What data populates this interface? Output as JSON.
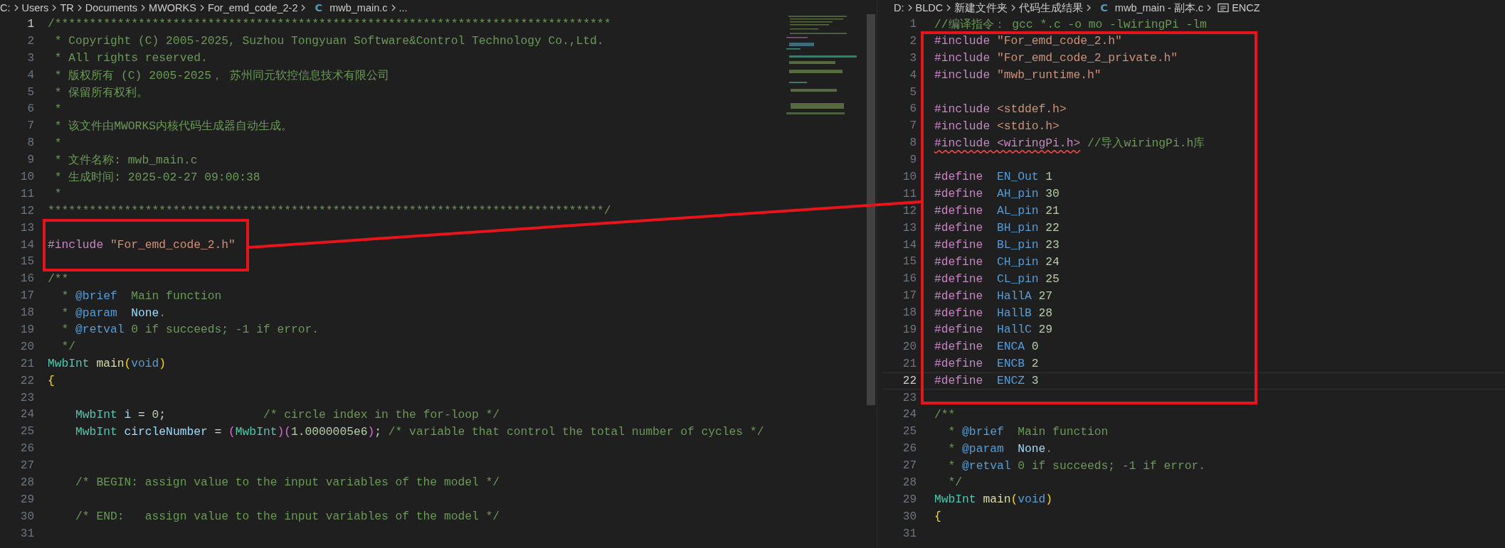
{
  "panes": [
    {
      "breadcrumb": [
        {
          "kind": "segment",
          "label": "C:"
        },
        {
          "kind": "segment",
          "label": "Users"
        },
        {
          "kind": "segment",
          "label": "TR"
        },
        {
          "kind": "segment",
          "label": "Documents"
        },
        {
          "kind": "segment",
          "label": "MWORKS"
        },
        {
          "kind": "segment",
          "label": "For_emd_code_2-2"
        },
        {
          "kind": "file",
          "icon": "C",
          "label": "mwb_main.c"
        },
        {
          "kind": "segment",
          "label": "..."
        }
      ],
      "lines": [
        {
          "number": "1",
          "active": true,
          "tokens": [
            {
              "kind": "c",
              "text": "/********************************************************************************"
            }
          ]
        },
        {
          "number": "2",
          "active": false,
          "tokens": [
            {
              "kind": "c",
              "text": " * Copyright (C) 2005-2025, Suzhou Tongyuan Software&Control Technology Co.,Ltd."
            }
          ]
        },
        {
          "number": "3",
          "active": false,
          "tokens": [
            {
              "kind": "c",
              "text": " * All rights reserved."
            }
          ]
        },
        {
          "number": "4",
          "active": false,
          "tokens": [
            {
              "kind": "c",
              "text": " * 版权所有 (C) 2005-2025， 苏州同元软控信息技术有限公司"
            }
          ]
        },
        {
          "number": "5",
          "active": false,
          "tokens": [
            {
              "kind": "c",
              "text": " * 保留所有权利。"
            }
          ]
        },
        {
          "number": "6",
          "active": false,
          "tokens": [
            {
              "kind": "c",
              "text": " *"
            }
          ]
        },
        {
          "number": "7",
          "active": false,
          "tokens": [
            {
              "kind": "c",
              "text": " * 该文件由MWORKS内核代码生成器自动生成。"
            }
          ]
        },
        {
          "number": "8",
          "active": false,
          "tokens": [
            {
              "kind": "c",
              "text": " *"
            }
          ]
        },
        {
          "number": "9",
          "active": false,
          "tokens": [
            {
              "kind": "c",
              "text": " * 文件名称: mwb_main.c"
            }
          ]
        },
        {
          "number": "10",
          "active": false,
          "tokens": [
            {
              "kind": "c",
              "text": " * 生成时间: 2025-02-27 09:00:38"
            }
          ]
        },
        {
          "number": "11",
          "active": false,
          "tokens": [
            {
              "kind": "c",
              "text": " *"
            }
          ]
        },
        {
          "number": "12",
          "active": false,
          "tokens": [
            {
              "kind": "c",
              "text": "********************************************************************************/"
            }
          ]
        },
        {
          "number": "13",
          "active": false
        },
        {
          "number": "14",
          "active": false,
          "tokens": [
            {
              "kind": "pp",
              "text": "#include"
            },
            {
              "kind": "s",
              "text": " \"For_emd_code_2.h\""
            }
          ]
        },
        {
          "number": "15",
          "active": false
        },
        {
          "number": "16",
          "active": false,
          "tokens": [
            {
              "kind": "c",
              "text": "/**"
            }
          ]
        },
        {
          "number": "17",
          "active": false,
          "tokens": [
            {
              "kind": "c",
              "text": "  * "
            },
            {
              "kind": "tag",
              "text": "@brief"
            },
            {
              "kind": "c",
              "text": "  Main function"
            }
          ]
        },
        {
          "number": "18",
          "active": false,
          "tokens": [
            {
              "kind": "c",
              "text": "  * "
            },
            {
              "kind": "tag",
              "text": "@param"
            },
            {
              "kind": "v",
              "text": "  None"
            },
            {
              "kind": "c",
              "text": "."
            }
          ]
        },
        {
          "number": "19",
          "active": false,
          "tokens": [
            {
              "kind": "c",
              "text": "  * "
            },
            {
              "kind": "tag",
              "text": "@retval"
            },
            {
              "kind": "c",
              "text": " 0 if succeeds; -1 if error."
            }
          ]
        },
        {
          "number": "20",
          "active": false,
          "tokens": [
            {
              "kind": "c",
              "text": "  */"
            }
          ]
        },
        {
          "number": "21",
          "active": false,
          "tokens": [
            {
              "kind": "t",
              "text": "MwbInt"
            },
            {
              "kind": "f",
              "text": " main"
            },
            {
              "kind": "b",
              "text": "("
            },
            {
              "kind": "kw",
              "text": "void"
            },
            {
              "kind": "b",
              "text": ")"
            }
          ]
        },
        {
          "number": "22",
          "active": false,
          "tokens": [
            {
              "kind": "b",
              "text": "{"
            }
          ]
        },
        {
          "number": "23",
          "active": false
        },
        {
          "number": "24",
          "active": false,
          "tokens": [
            {
              "kind": "t",
              "text": "    MwbInt"
            },
            {
              "kind": "v",
              "text": " i"
            },
            {
              "kind": "p",
              "text": " = "
            },
            {
              "kind": "n",
              "text": "0"
            },
            {
              "kind": "p",
              "text": ";"
            },
            {
              "kind": "c",
              "text": "              /* circle index in the for-loop */"
            }
          ]
        },
        {
          "number": "25",
          "active": false,
          "tokens": [
            {
              "kind": "t",
              "text": "    MwbInt"
            },
            {
              "kind": "v",
              "text": " circleNumber"
            },
            {
              "kind": "p",
              "text": " = "
            },
            {
              "kind": "p2",
              "text": "("
            },
            {
              "kind": "t",
              "text": "MwbInt"
            },
            {
              "kind": "p2",
              "text": ")("
            },
            {
              "kind": "n",
              "text": "1.0000005e6"
            },
            {
              "kind": "p2",
              "text": ")"
            },
            {
              "kind": "p",
              "text": "; "
            },
            {
              "kind": "c",
              "text": "/* variable that control the total number of cycles */"
            }
          ]
        },
        {
          "number": "26",
          "active": false
        },
        {
          "number": "27",
          "active": false
        },
        {
          "number": "28",
          "active": false,
          "tokens": [
            {
              "kind": "c",
              "text": "    /* BEGIN: assign value to the input variables of the model */"
            }
          ]
        },
        {
          "number": "29",
          "active": false
        },
        {
          "number": "30",
          "active": false,
          "tokens": [
            {
              "kind": "c",
              "text": "    /* END:   assign value to the input variables of the model */"
            }
          ]
        },
        {
          "number": "31",
          "active": false
        }
      ]
    },
    {
      "breadcrumb": [
        {
          "kind": "segment",
          "label": "D:"
        },
        {
          "kind": "segment",
          "label": "BLDC"
        },
        {
          "kind": "segment",
          "label": "新建文件夹"
        },
        {
          "kind": "segment",
          "label": "代码生成结果"
        },
        {
          "kind": "file",
          "icon": "C",
          "label": "mwb_main - 副本.c"
        },
        {
          "kind": "symbol",
          "label": "ENCZ"
        }
      ],
      "lines": [
        {
          "number": "1",
          "active": false,
          "tokens": [
            {
              "kind": "c",
              "text": "//编译指令： gcc *.c -o mo -lwiringPi -lm"
            }
          ]
        },
        {
          "number": "2",
          "active": false,
          "tokens": [
            {
              "kind": "pp",
              "text": "#include"
            },
            {
              "kind": "s",
              "text": " \"For_emd_code_2.h\""
            }
          ]
        },
        {
          "number": "3",
          "active": false,
          "tokens": [
            {
              "kind": "pp",
              "text": "#include"
            },
            {
              "kind": "s",
              "text": " \"For_emd_code_2_private.h\""
            }
          ]
        },
        {
          "number": "4",
          "active": false,
          "tokens": [
            {
              "kind": "pp",
              "text": "#include"
            },
            {
              "kind": "s",
              "text": " \"mwb_runtime.h\""
            }
          ]
        },
        {
          "number": "5",
          "active": false
        },
        {
          "number": "6",
          "active": false,
          "tokens": [
            {
              "kind": "pp",
              "text": "#include"
            },
            {
              "kind": "s",
              "text": " <stddef.h>"
            }
          ]
        },
        {
          "number": "7",
          "active": false,
          "tokens": [
            {
              "kind": "pp",
              "text": "#include"
            },
            {
              "kind": "s",
              "text": " <stdio.h>"
            }
          ]
        },
        {
          "number": "8",
          "active": false,
          "tokens": [
            {
              "kind": "pp_err",
              "text": "#include <wiringPi.h>"
            },
            {
              "kind": "c",
              "text": " //导入wiringPi.h库"
            }
          ]
        },
        {
          "number": "9",
          "active": false
        },
        {
          "number": "10",
          "active": false,
          "tokens": [
            {
              "kind": "pp",
              "text": "#define"
            },
            {
              "kind": "m",
              "text": "  EN_Out"
            },
            {
              "kind": "n",
              "text": " 1"
            }
          ]
        },
        {
          "number": "11",
          "active": false,
          "tokens": [
            {
              "kind": "pp",
              "text": "#define"
            },
            {
              "kind": "m",
              "text": "  AH_pin"
            },
            {
              "kind": "n",
              "text": " 30"
            }
          ]
        },
        {
          "number": "12",
          "active": false,
          "tokens": [
            {
              "kind": "pp",
              "text": "#define"
            },
            {
              "kind": "m",
              "text": "  AL_pin"
            },
            {
              "kind": "n",
              "text": " 21"
            }
          ]
        },
        {
          "number": "13",
          "active": false,
          "tokens": [
            {
              "kind": "pp",
              "text": "#define"
            },
            {
              "kind": "m",
              "text": "  BH_pin"
            },
            {
              "kind": "n",
              "text": " 22"
            }
          ]
        },
        {
          "number": "14",
          "active": false,
          "tokens": [
            {
              "kind": "pp",
              "text": "#define"
            },
            {
              "kind": "m",
              "text": "  BL_pin"
            },
            {
              "kind": "n",
              "text": " 23"
            }
          ]
        },
        {
          "number": "15",
          "active": false,
          "tokens": [
            {
              "kind": "pp",
              "text": "#define"
            },
            {
              "kind": "m",
              "text": "  CH_pin"
            },
            {
              "kind": "n",
              "text": " 24"
            }
          ]
        },
        {
          "number": "16",
          "active": false,
          "tokens": [
            {
              "kind": "pp",
              "text": "#define"
            },
            {
              "kind": "m",
              "text": "  CL_pin"
            },
            {
              "kind": "n",
              "text": " 25"
            }
          ]
        },
        {
          "number": "17",
          "active": false,
          "tokens": [
            {
              "kind": "pp",
              "text": "#define"
            },
            {
              "kind": "m",
              "text": "  HallA"
            },
            {
              "kind": "n",
              "text": " 27"
            }
          ]
        },
        {
          "number": "18",
          "active": false,
          "tokens": [
            {
              "kind": "pp",
              "text": "#define"
            },
            {
              "kind": "m",
              "text": "  HallB"
            },
            {
              "kind": "n",
              "text": " 28"
            }
          ]
        },
        {
          "number": "19",
          "active": false,
          "tokens": [
            {
              "kind": "pp",
              "text": "#define"
            },
            {
              "kind": "m",
              "text": "  HallC"
            },
            {
              "kind": "n",
              "text": " 29"
            }
          ]
        },
        {
          "number": "20",
          "active": false,
          "tokens": [
            {
              "kind": "pp",
              "text": "#define"
            },
            {
              "kind": "m",
              "text": "  ENCA"
            },
            {
              "kind": "n",
              "text": " 0"
            }
          ]
        },
        {
          "number": "21",
          "active": false,
          "tokens": [
            {
              "kind": "pp",
              "text": "#define"
            },
            {
              "kind": "m",
              "text": "  ENCB"
            },
            {
              "kind": "n",
              "text": " 2"
            }
          ]
        },
        {
          "number": "22",
          "active": true,
          "tokens": [
            {
              "kind": "pp",
              "text": "#define"
            },
            {
              "kind": "m",
              "text": "  ENCZ"
            },
            {
              "kind": "n",
              "text": " 3"
            }
          ]
        },
        {
          "number": "23",
          "active": false
        },
        {
          "number": "24",
          "active": false,
          "tokens": [
            {
              "kind": "c",
              "text": "/**"
            }
          ]
        },
        {
          "number": "25",
          "active": false,
          "tokens": [
            {
              "kind": "c",
              "text": "  * "
            },
            {
              "kind": "tag",
              "text": "@brief"
            },
            {
              "kind": "c",
              "text": "  Main function"
            }
          ]
        },
        {
          "number": "26",
          "active": false,
          "tokens": [
            {
              "kind": "c",
              "text": "  * "
            },
            {
              "kind": "tag",
              "text": "@param"
            },
            {
              "kind": "v",
              "text": "  None"
            },
            {
              "kind": "c",
              "text": "."
            }
          ]
        },
        {
          "number": "27",
          "active": false,
          "tokens": [
            {
              "kind": "c",
              "text": "  * "
            },
            {
              "kind": "tag",
              "text": "@retval"
            },
            {
              "kind": "c",
              "text": " 0 if succeeds; -1 if error."
            }
          ]
        },
        {
          "number": "28",
          "active": false,
          "tokens": [
            {
              "kind": "c",
              "text": "  */"
            }
          ]
        },
        {
          "number": "29",
          "active": false,
          "tokens": [
            {
              "kind": "t",
              "text": "MwbInt"
            },
            {
              "kind": "f",
              "text": " main"
            },
            {
              "kind": "b",
              "text": "("
            },
            {
              "kind": "kw",
              "text": "void"
            },
            {
              "kind": "b",
              "text": ")"
            }
          ]
        },
        {
          "number": "30",
          "active": false,
          "tokens": [
            {
              "kind": "b",
              "text": "{"
            }
          ]
        },
        {
          "number": "31",
          "active": false
        }
      ]
    }
  ]
}
